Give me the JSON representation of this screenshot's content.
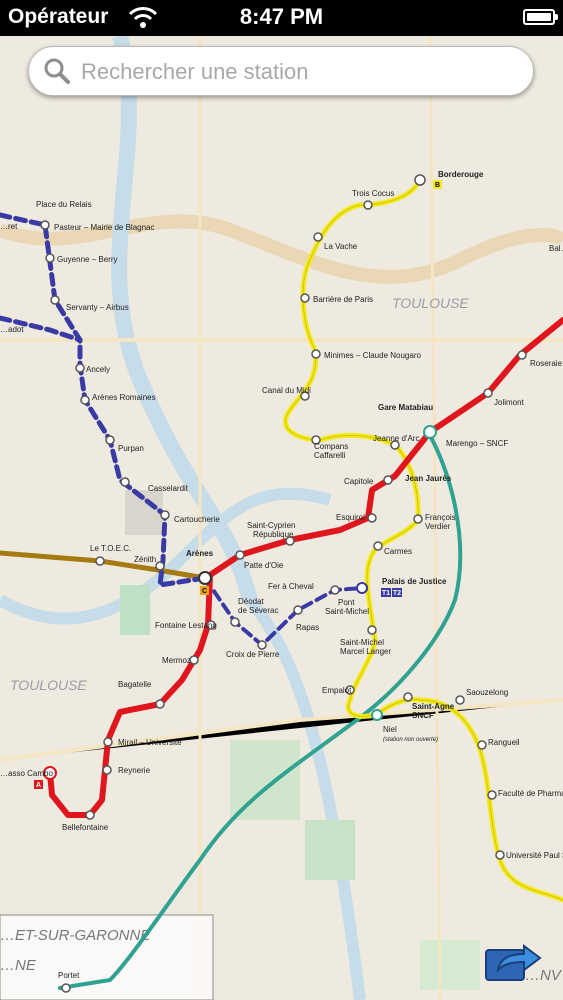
{
  "status_bar": {
    "carrier": "Opérateur",
    "time": "8:47 PM"
  },
  "search": {
    "placeholder": "Rechercher une station"
  },
  "map": {
    "city_labels": [
      "TOULOUSE",
      "TOULOUSE",
      "…ET-SUR-GARONNE",
      "…NE",
      "…NV"
    ],
    "line_badges": {
      "B": "B",
      "C": "C",
      "A": "A",
      "T1": "T1",
      "T2": "T2"
    },
    "line_colors": {
      "A": "#e0161e",
      "B": "#f4ea1a",
      "C": "#3a3aa5",
      "T": "#2fa291",
      "brown": "#a67a12"
    },
    "stations": {
      "borderouge": "Borderouge",
      "trois_cocus": "Trois Cocus",
      "la_vache": "La Vache",
      "barriere_de_paris": "Barrière de Paris",
      "minimes": "Minimes – Claude Nougaro",
      "canal_du_midi": "Canal du Midi",
      "compans_1": "Compans",
      "compans_2": "Caffarelli",
      "jeanne_darc": "Jeanne d'Arc",
      "capitole": "Capitole",
      "jean_jaures": "Jean Jaurès",
      "francois_1": "François",
      "francois_2": "Verdier",
      "carmes": "Carmes",
      "palais_de_justice": "Palais de Justice",
      "st_michel_1": "Saint-Michel",
      "st_michel_2": "Marcel Langer",
      "empalot": "Empalot",
      "st_agne_1": "Saint-Agne",
      "st_agne_2": "SNCF",
      "niel": "Niel",
      "niel_note": "(station non ouverte)",
      "saouzelong": "Saouzelong",
      "rangueil": "Rangueil",
      "faculte": "Faculté de Pharmacie",
      "universite": "Université Paul Sabatier",
      "gare_matabiau": "Gare Matabiau",
      "marengo": "Marengo – SNCF",
      "jolimont": "Jolimont",
      "roseraie": "Roseraie",
      "esquirol": "Esquirol",
      "st_cyprien_1": "Saint-Cyprien",
      "st_cyprien_2": "République",
      "patte_doie": "Patte d'Oie",
      "arenes": "Arènes",
      "fontaine_lestang": "Fontaine Lestang",
      "mermoz": "Mermoz",
      "bagatelle": "Bagatelle",
      "mirail_universite": "Mirail – Université",
      "reynerie": "Reynerie",
      "bellefontaine": "Bellefontaine",
      "basso_cambo": "…asso Cambo",
      "place_du_relais": "Place du Relais",
      "pasteur": "Pasteur – Mairie de Blagnac",
      "guyenne_berry": "Guyenne – Berry",
      "servanty": "Servanty – Airbus",
      "ancely": "Ancely",
      "arenes_romaines": "Arènes Romaines",
      "purpan": "Purpan",
      "casselardit": "Casselardit",
      "cartoucherie": "Cartoucherie",
      "zenith": "Zénith",
      "le_tocec": "Le T.O.E.C.",
      "fer_a_cheval": "Fer à Cheval",
      "deodat_1": "Déodat",
      "deodat_2": "de Séverac",
      "rapas": "Rapas",
      "pont_st_michel_1": "Pont",
      "pont_st_michel_2": "Saint-Michel",
      "croix_de_pierre": "Croix de Pierre",
      "portet": "Portet",
      "edge_ret": "…ret",
      "edge_adot": "…adot",
      "edge_bal": "Bal…"
    }
  }
}
